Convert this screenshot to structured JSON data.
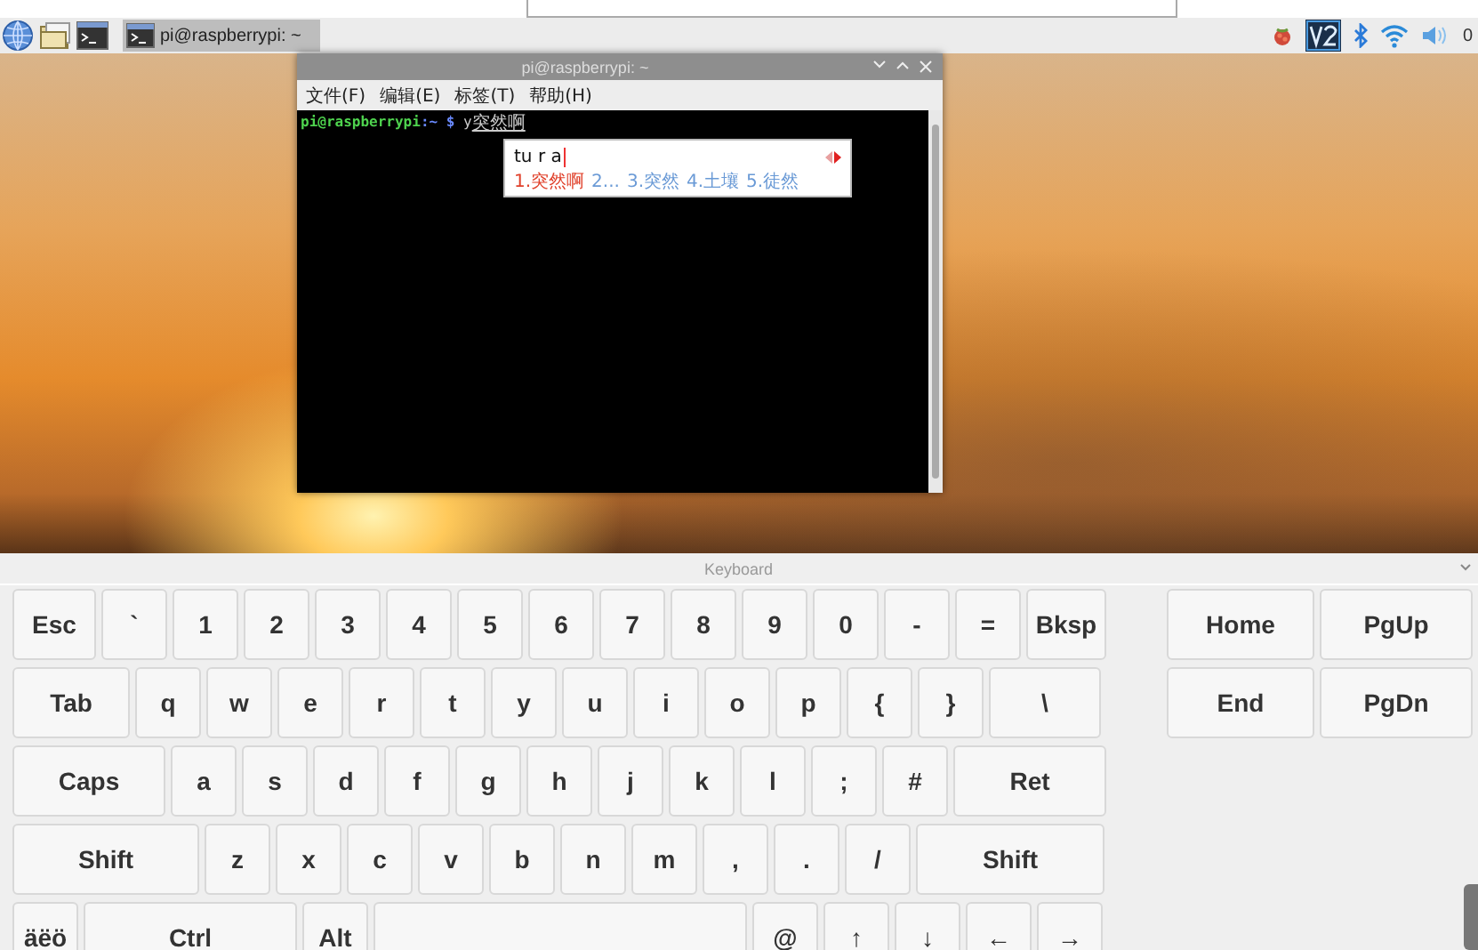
{
  "taskbar": {
    "task": {
      "label": "pi@raspberrypi: ~",
      "selected": true
    },
    "clock": "0"
  },
  "terminal": {
    "title": "pi@raspberrypi: ~",
    "menu": [
      "文件(F)",
      "编辑(E)",
      "标签(T)",
      "帮助(H)"
    ],
    "prompt_user": "pi@raspberrypi",
    "prompt_path": ":~ $",
    "typed": "y",
    "preedit": "突然啊"
  },
  "ime": {
    "input": "tu r a",
    "candidates": [
      {
        "label": "1.突然啊",
        "selected": true
      },
      {
        "label": "2...",
        "selected": false
      },
      {
        "label": "3.突然",
        "selected": false
      },
      {
        "label": "4.土壤",
        "selected": false
      },
      {
        "label": "5.徒然",
        "selected": false
      }
    ]
  },
  "keyboard": {
    "title": "Keyboard",
    "main_rows": [
      [
        {
          "kind": "key",
          "label": "Esc"
        },
        {
          "kind": "key",
          "label": "`"
        },
        {
          "kind": "key",
          "label": "1"
        },
        {
          "kind": "key",
          "label": "2"
        },
        {
          "kind": "key",
          "label": "3"
        },
        {
          "kind": "key",
          "label": "4"
        },
        {
          "kind": "key",
          "label": "5"
        },
        {
          "kind": "key",
          "label": "6"
        },
        {
          "kind": "key",
          "label": "7"
        },
        {
          "kind": "key",
          "label": "8"
        },
        {
          "kind": "key",
          "label": "9"
        },
        {
          "kind": "key",
          "label": "0"
        },
        {
          "kind": "key",
          "label": "-"
        },
        {
          "kind": "key",
          "label": "="
        },
        {
          "kind": "key",
          "label": "Bksp"
        }
      ],
      [
        {
          "kind": "key",
          "label": "Tab"
        },
        {
          "kind": "key",
          "label": "q"
        },
        {
          "kind": "key",
          "label": "w"
        },
        {
          "kind": "key",
          "label": "e"
        },
        {
          "kind": "key",
          "label": "r"
        },
        {
          "kind": "key",
          "label": "t"
        },
        {
          "kind": "key",
          "label": "y"
        },
        {
          "kind": "key",
          "label": "u"
        },
        {
          "kind": "key",
          "label": "i"
        },
        {
          "kind": "key",
          "label": "o"
        },
        {
          "kind": "key",
          "label": "p"
        },
        {
          "kind": "key",
          "label": "{"
        },
        {
          "kind": "key",
          "label": "}"
        },
        {
          "kind": "key",
          "label": "\\"
        }
      ],
      [
        {
          "kind": "key",
          "label": "Caps"
        },
        {
          "kind": "key",
          "label": "a"
        },
        {
          "kind": "key",
          "label": "s"
        },
        {
          "kind": "key",
          "label": "d"
        },
        {
          "kind": "key",
          "label": "f"
        },
        {
          "kind": "key",
          "label": "g"
        },
        {
          "kind": "key",
          "label": "h"
        },
        {
          "kind": "key",
          "label": "j"
        },
        {
          "kind": "key",
          "label": "k"
        },
        {
          "kind": "key",
          "label": "l"
        },
        {
          "kind": "key",
          "label": ";"
        },
        {
          "kind": "key",
          "label": "#"
        },
        {
          "kind": "key",
          "label": "Ret"
        }
      ],
      [
        {
          "kind": "key",
          "label": "Shift"
        },
        {
          "kind": "key",
          "label": "z"
        },
        {
          "kind": "key",
          "label": "x"
        },
        {
          "kind": "key",
          "label": "c"
        },
        {
          "kind": "key",
          "label": "v"
        },
        {
          "kind": "key",
          "label": "b"
        },
        {
          "kind": "key",
          "label": "n"
        },
        {
          "kind": "key",
          "label": "m"
        },
        {
          "kind": "key",
          "label": ","
        },
        {
          "kind": "key",
          "label": "."
        },
        {
          "kind": "key",
          "label": "/"
        },
        {
          "kind": "key",
          "label": "Shift"
        }
      ],
      [
        {
          "kind": "key",
          "label": "äëö"
        },
        {
          "kind": "key",
          "label": "Ctrl"
        },
        {
          "kind": "key",
          "label": "Alt"
        },
        {
          "kind": "space"
        },
        {
          "kind": "key",
          "label": "@"
        },
        {
          "kind": "key",
          "label": "↑"
        },
        {
          "kind": "key",
          "label": "↓"
        },
        {
          "kind": "key",
          "label": "←"
        },
        {
          "kind": "key",
          "label": "→"
        }
      ]
    ],
    "nav_rows": [
      [
        "Home",
        "PgUp"
      ],
      [
        "End",
        "PgDn"
      ]
    ]
  }
}
